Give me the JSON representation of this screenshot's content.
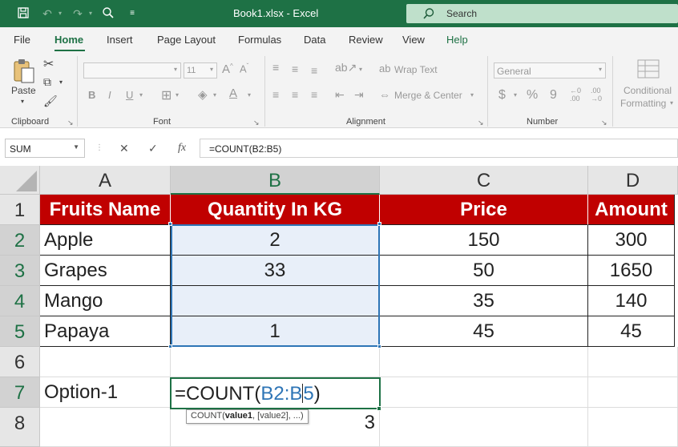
{
  "titlebar": {
    "title": "Book1.xlsx  -  Excel",
    "search_placeholder": "Search",
    "icons": [
      "save-icon",
      "undo-icon",
      "redo-icon",
      "touch-mode-icon",
      "customize-qat-icon"
    ],
    "color": "#1e7145"
  },
  "ribbon_tabs": [
    "File",
    "Home",
    "Insert",
    "Page Layout",
    "Formulas",
    "Data",
    "Review",
    "View",
    "Help"
  ],
  "active_tab": "Home",
  "ribbon": {
    "clipboard": {
      "label": "Clipboard",
      "paste": "Paste"
    },
    "font": {
      "label": "Font",
      "size": "11",
      "bold": "B",
      "italic": "I",
      "underline": "U"
    },
    "alignment": {
      "label": "Alignment",
      "wrap_text": "Wrap Text",
      "merge_center": "Merge & Center"
    },
    "number": {
      "label": "Number",
      "format": "General",
      "currency": "$",
      "percent": "%",
      "comma": "9"
    },
    "styles": {
      "conditional_formatting_line1": "Conditional",
      "conditional_formatting_line2": "Formatting"
    }
  },
  "formula_bar": {
    "name_box": "SUM",
    "cancel": "✕",
    "enter": "✓",
    "fx": "fx",
    "formula": "=COUNT(B2:B5)"
  },
  "sheet": {
    "columns": [
      "A",
      "B",
      "C",
      "D"
    ],
    "rows": [
      "1",
      "2",
      "3",
      "4",
      "5",
      "6",
      "7",
      "8"
    ],
    "header_row": [
      "Fruits Name",
      "Quantity In KG",
      "Price",
      "Amount"
    ],
    "data": [
      [
        "Apple",
        "2",
        "150",
        "300"
      ],
      [
        "Grapes",
        "33",
        "50",
        "1650"
      ],
      [
        "Mango",
        "",
        "35",
        "140"
      ],
      [
        "Papaya",
        "1",
        "45",
        "45"
      ]
    ],
    "a7": "Option-1",
    "b8": "3",
    "editing": {
      "prefix": "=COUNT(",
      "ref_part1": "B2:B",
      "ref_part2": "5",
      "suffix": ")"
    },
    "tooltip": {
      "fn": "COUNT(",
      "arg1": "value1",
      "rest": ", [value2], ...)"
    },
    "header_fill": "#c00000",
    "selection_color": "#2e75b6"
  }
}
